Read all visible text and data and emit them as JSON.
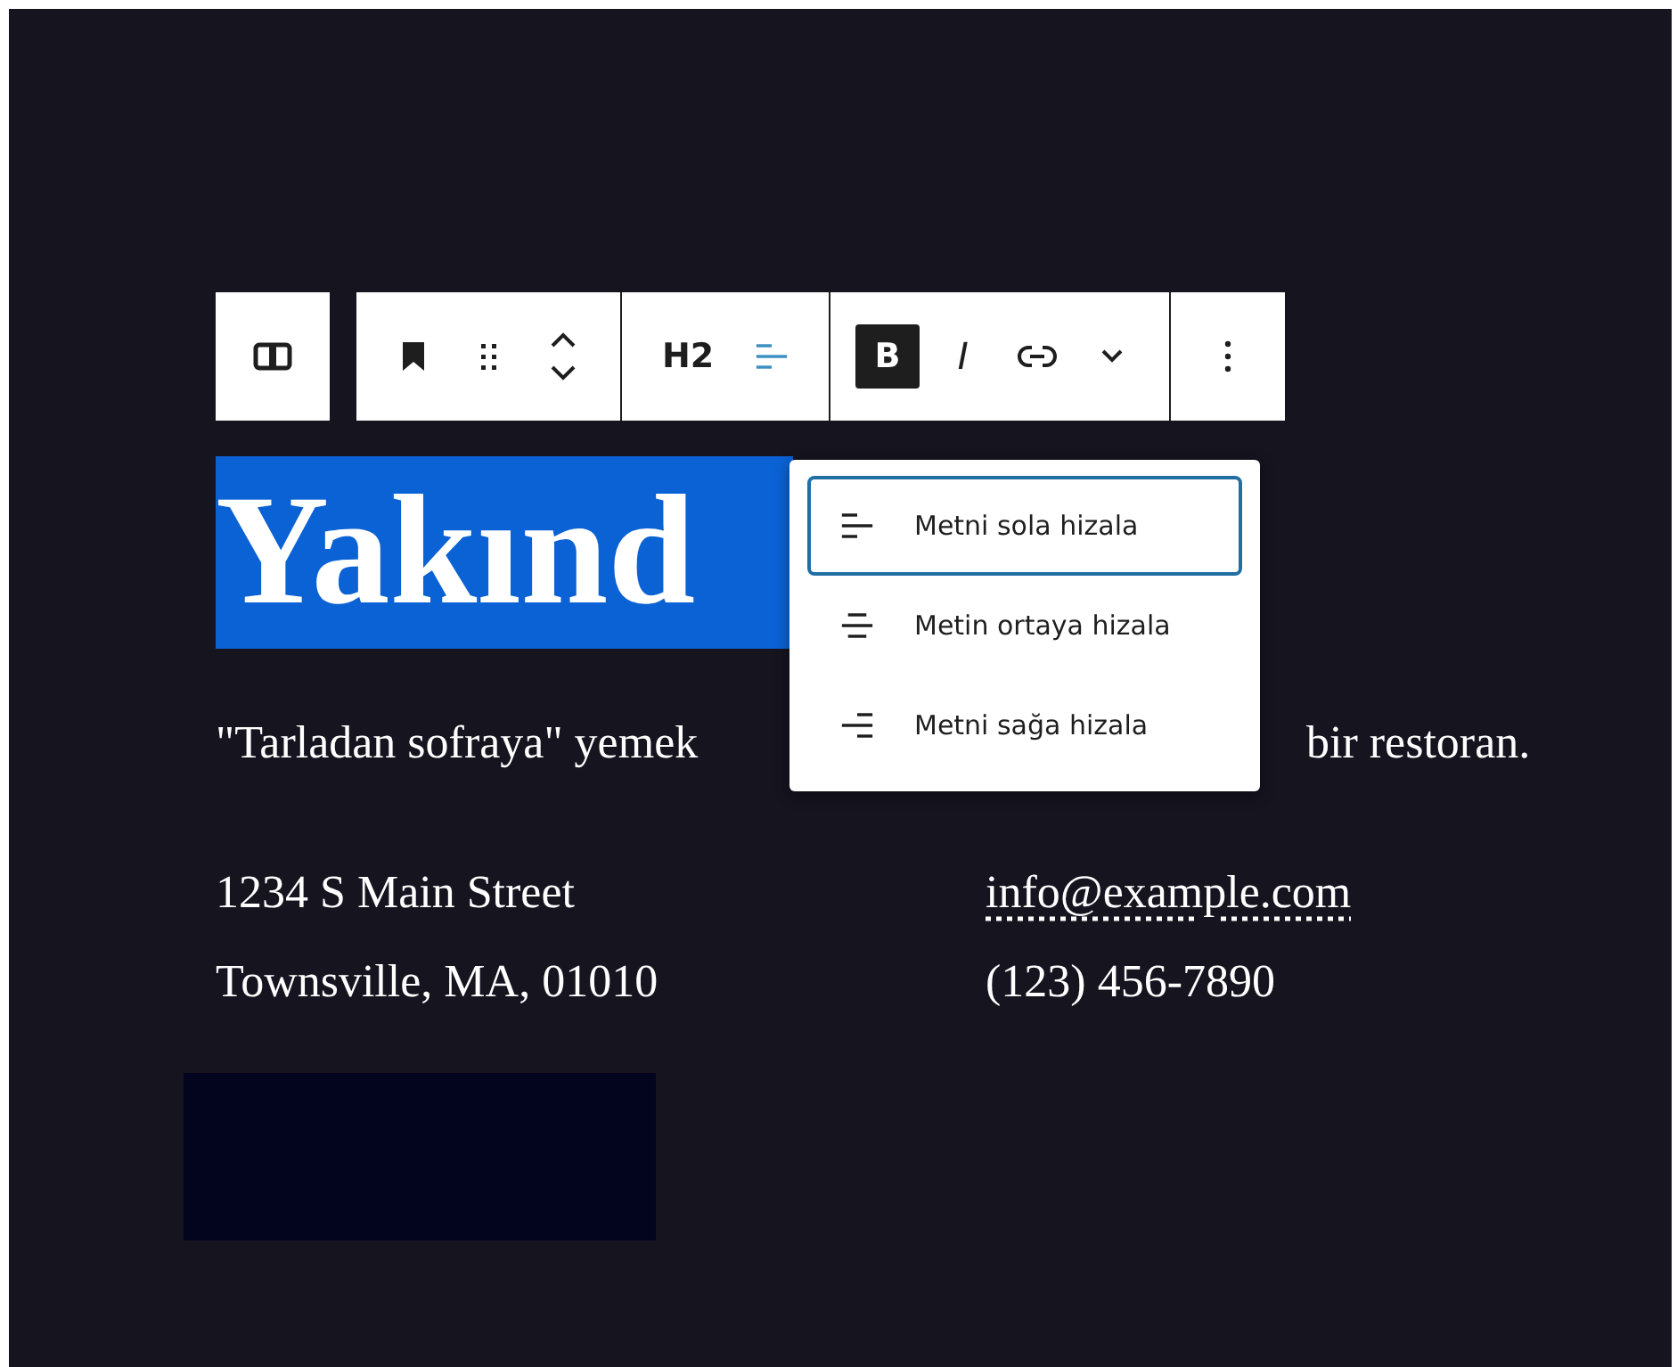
{
  "toolbar": {
    "groups": [
      {
        "buttons": [
          {
            "kind": "block-type"
          }
        ]
      },
      {
        "buttons": [
          {
            "kind": "bookmark"
          },
          {
            "kind": "drag"
          },
          {
            "kind": "move"
          }
        ]
      },
      {
        "buttons": [
          {
            "kind": "heading",
            "label": "H2"
          },
          {
            "kind": "align",
            "expanded": true
          }
        ]
      },
      {
        "buttons": [
          {
            "kind": "bold",
            "label": "B",
            "selected": true
          },
          {
            "kind": "italic",
            "label": "I",
            "selected": false
          },
          {
            "kind": "link"
          },
          {
            "kind": "more"
          }
        ]
      },
      {
        "buttons": [
          {
            "kind": "options"
          }
        ]
      }
    ]
  },
  "heading": {
    "text": "Yakınd",
    "selected": true
  },
  "paragraph": {
    "start": "\"Tarladan sofraya\" yemek",
    "end": "bir restoran."
  },
  "address": {
    "street": "1234 S Main Street",
    "city": "Townsville, MA, 01010"
  },
  "contact": {
    "email": "info@example.com",
    "phone": "(123) 456-7890"
  },
  "align_menu": {
    "items": [
      {
        "kind": "left",
        "label": "Metni sola hizala",
        "selected": true
      },
      {
        "kind": "center",
        "label": "Metin ortaya hizala",
        "selected": false
      },
      {
        "kind": "right",
        "label": "Metni sağa hizala",
        "selected": false
      }
    ]
  }
}
